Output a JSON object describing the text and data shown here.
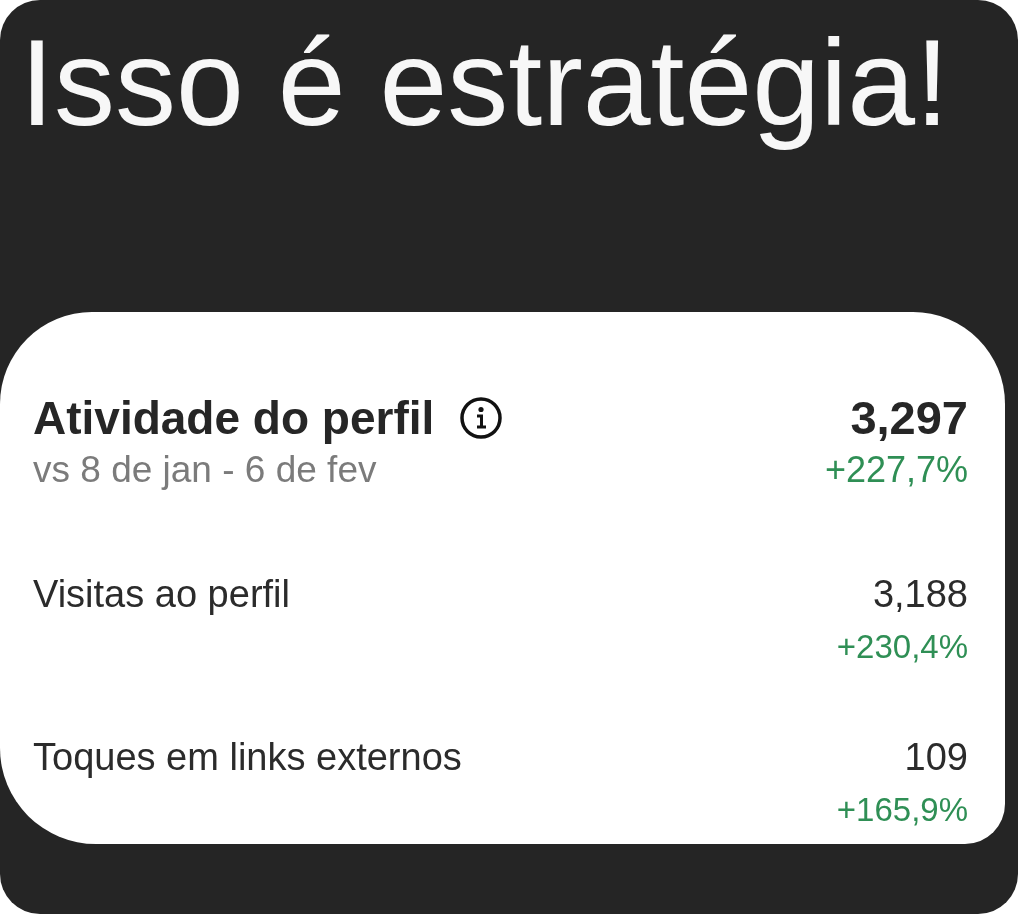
{
  "headline": "Isso é estratégia!",
  "card": {
    "title": "Atividade do perfil",
    "total": "3,297",
    "period": "vs 8 de jan - 6 de fev",
    "total_change": "+227,7%",
    "metrics": [
      {
        "label": "Visitas ao perfil",
        "value": "3,188",
        "change": "+230,4%"
      },
      {
        "label": "Toques em links externos",
        "value": "109",
        "change": "+165,9%"
      }
    ]
  }
}
